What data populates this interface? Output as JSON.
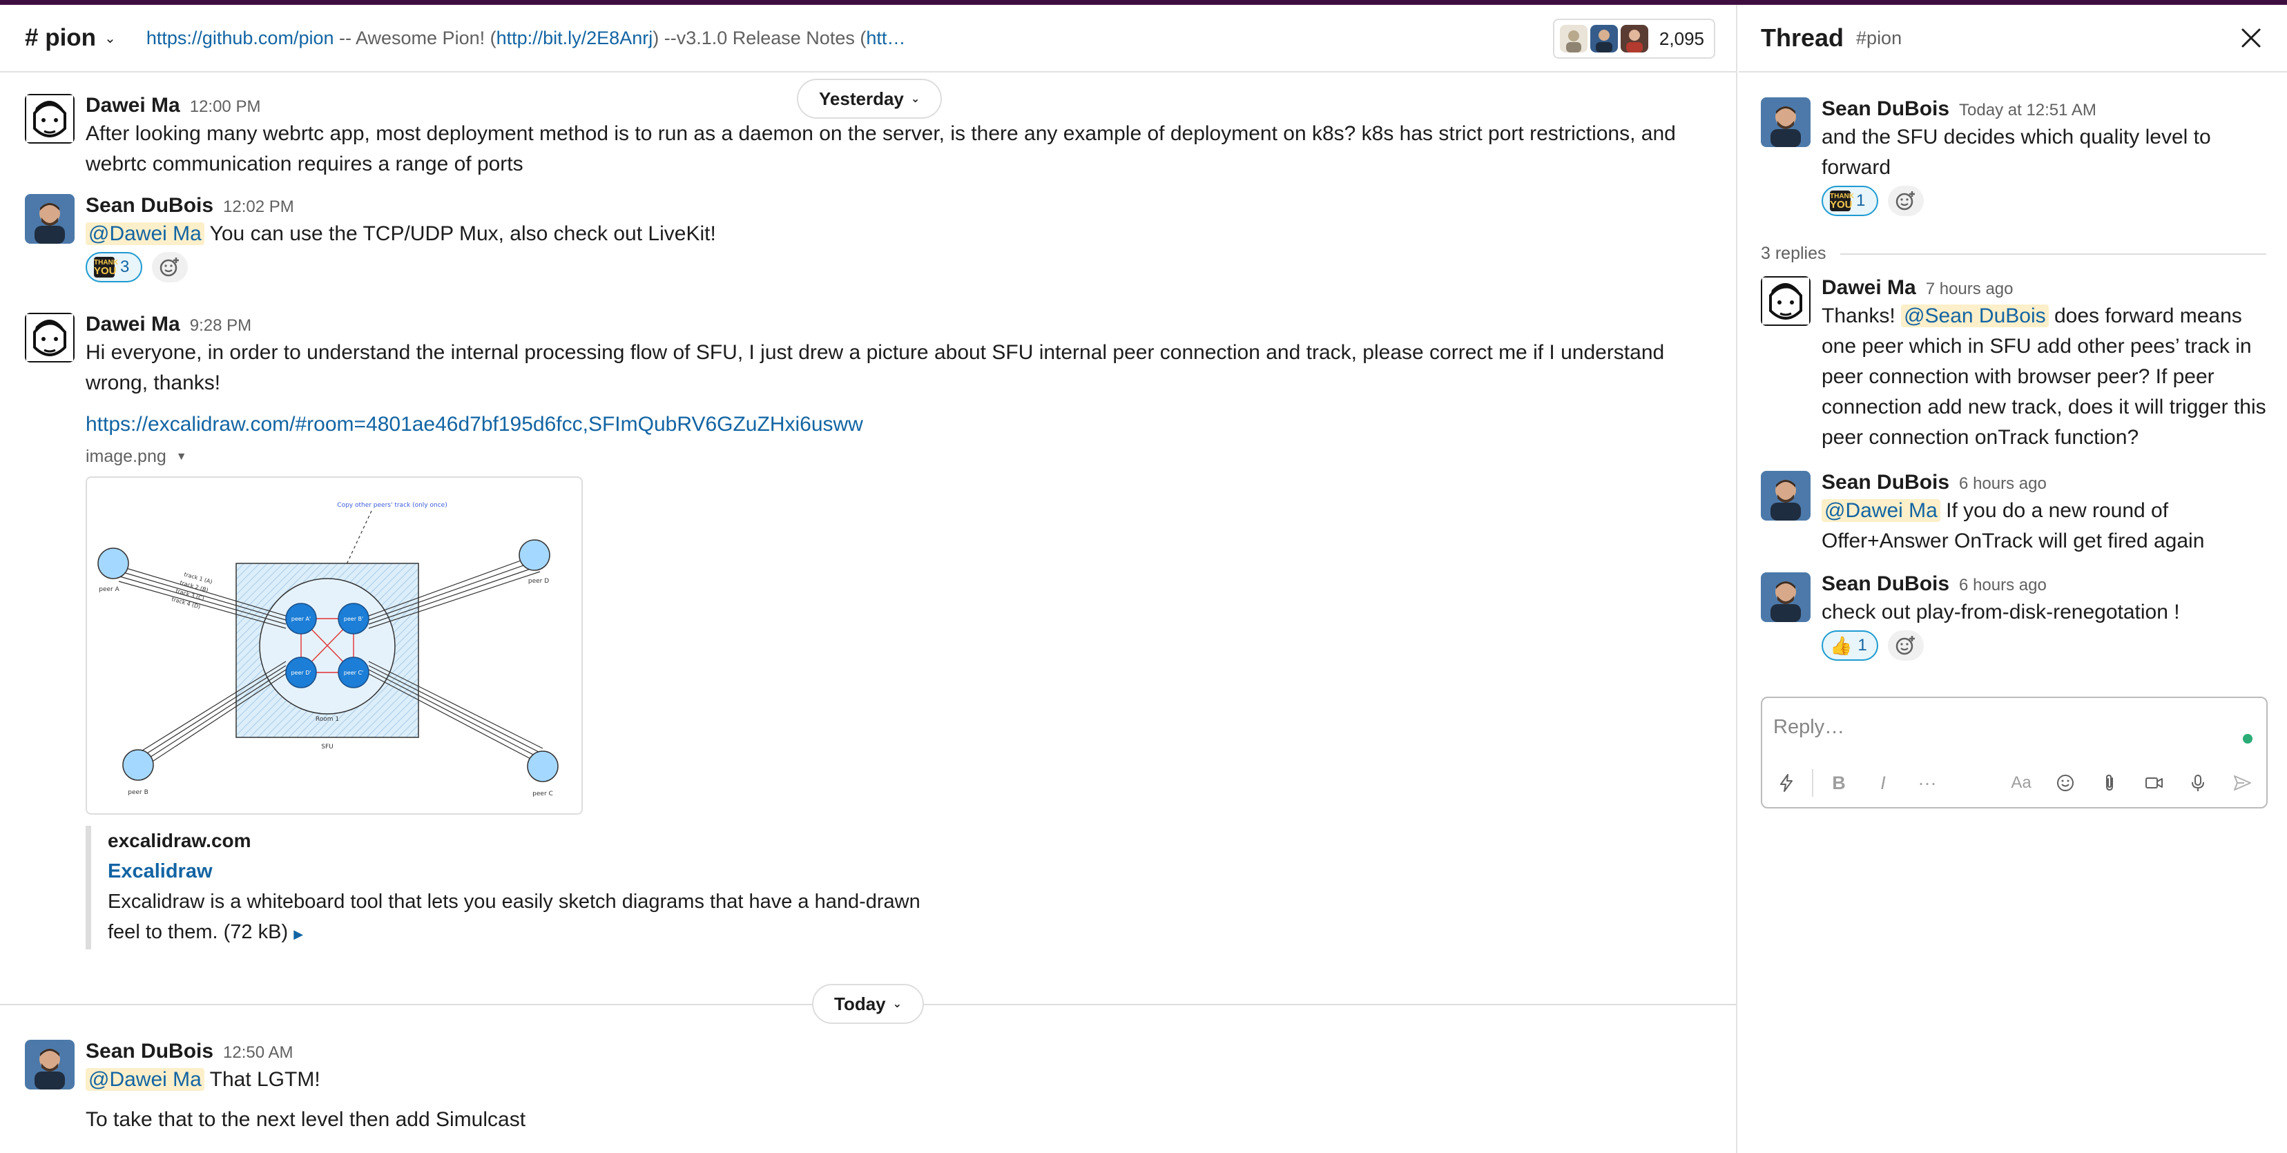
{
  "channel": {
    "name": "# pion",
    "topic": {
      "link1": "https://github.com/pion",
      "sep1": " --  Awesome Pion! (",
      "link2": "http://bit.ly/2E8Anrj",
      "sep2": ") --v3.1.0 Release Notes (",
      "link3": "htt…"
    },
    "member_count": "2,095"
  },
  "dividers": {
    "yesterday": "Yesterday",
    "today": "Today"
  },
  "messages": [
    {
      "author": "Dawei Ma",
      "time": "12:00 PM",
      "text": "After looking many webrtc app, most deployment method is to run as a daemon on the server, is there any example of deployment on k8s? k8s has strict port restrictions, and webrtc communication requires a range of ports"
    },
    {
      "author": "Sean DuBois",
      "time": "12:02 PM",
      "mention": "@Dawei Ma",
      "text": " You can use the TCP/UDP Mux, also check out LiveKit!",
      "reaction_count": "3"
    },
    {
      "author": "Dawei Ma",
      "time": "9:28 PM",
      "text": "Hi everyone, in order to understand the internal processing flow of SFU, I just drew a picture about SFU internal peer connection and track, please correct me if I understand wrong, thanks!",
      "link": "https://excalidraw.com/#room=4801ae46d7bf195d6fcc,SFImQubRV6GZuZHxi6usww",
      "file_name": "image.png",
      "unfurl": {
        "site": "excalidraw.com",
        "title": "Excalidraw",
        "description": "Excalidraw is a whiteboard tool that lets you easily sketch diagrams that have a hand-drawn feel to them. (72 kB)"
      }
    },
    {
      "author": "Sean DuBois",
      "time": "12:50 AM",
      "mention": "@Dawei Ma",
      "text": " That LGTM!",
      "text2": "To take that to the next level then add Simulcast"
    }
  ],
  "thread": {
    "title": "Thread",
    "channel": "#pion",
    "parent": {
      "author": "Sean DuBois",
      "time": "Today at 12:51 AM",
      "text": "and the SFU decides which quality level to forward",
      "reaction_count": "1"
    },
    "replies_label": "3 replies",
    "replies": [
      {
        "author": "Dawei Ma",
        "time": "7 hours ago",
        "text_pre": "Thanks! ",
        "mention": "@Sean DuBois",
        "text": " does forward means one peer which in SFU add other pees’ track in peer connection with browser peer? If peer connection add new track, does it will trigger this peer connection onTrack function?"
      },
      {
        "author": "Sean DuBois",
        "time": "6 hours ago",
        "mention": "@Dawei Ma",
        "text": " If you do a new round of Offer+Answer OnTrack will get fired again"
      },
      {
        "author": "Sean DuBois",
        "time": "6 hours ago",
        "text": "check out play-from-disk-renegotation !",
        "reaction_count": "1"
      }
    ],
    "composer_placeholder": "Reply…"
  },
  "diagram": {
    "note": "Copy other peers' track (only once)",
    "room": "Room 1",
    "sfu": "SFU",
    "peer_a": "peer A",
    "peer_b": "peer B",
    "peer_c": "peer C",
    "peer_d": "peer D",
    "inner_a": "peer A'",
    "inner_b": "peer B'",
    "inner_c": "peer C'",
    "inner_d": "peer D'",
    "tracks": [
      "track 1 (A)",
      "track 2 (B)",
      "track 3 (C)",
      "track 4 (D)"
    ]
  },
  "icons": {
    "channel_chevron": "chevron-down-icon",
    "close": "close-icon",
    "add_reaction": "add-reaction-icon",
    "thankyou": "thank-you-emoji",
    "thumbsup": "thumbs-up-emoji"
  },
  "colors": {
    "link": "#1264a3",
    "mention_bg": "#fcefc9",
    "reaction_border": "#1d9bd1",
    "aubergine": "#3f0e40",
    "presence": "#2bac76"
  }
}
